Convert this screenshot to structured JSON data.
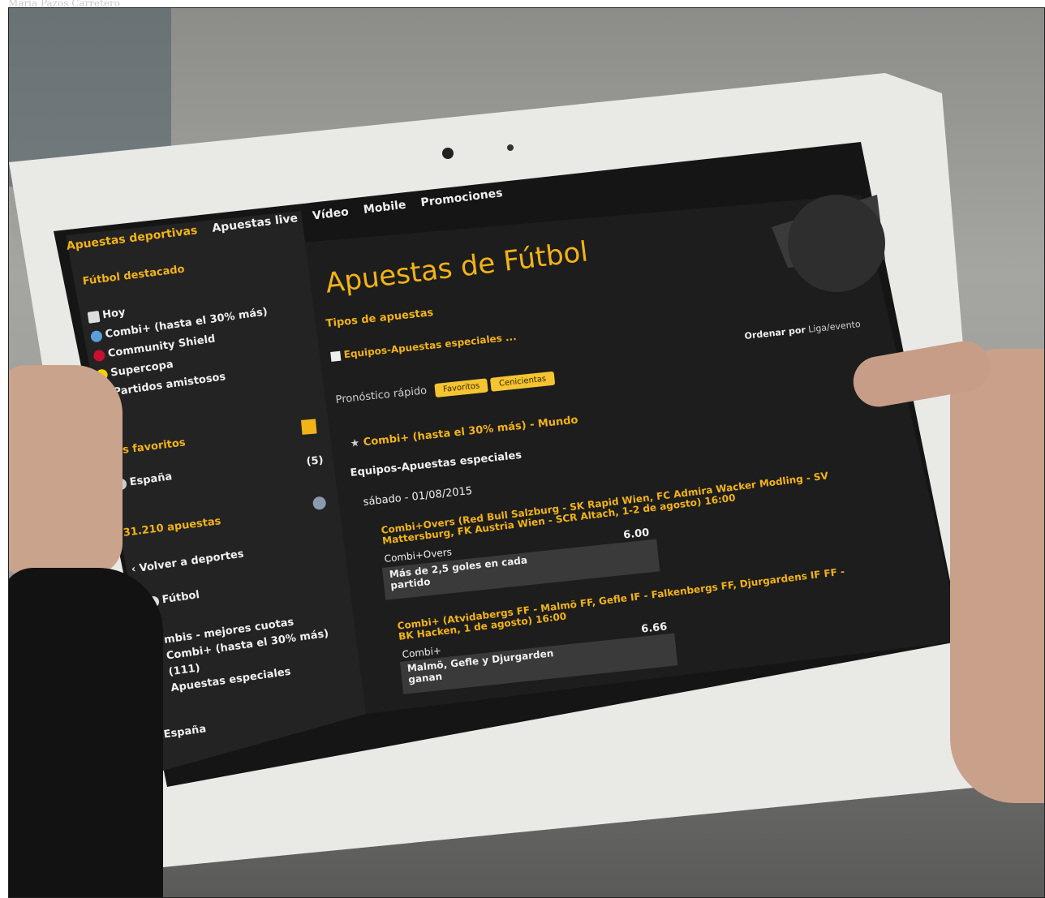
{
  "photo_credit": "María Pazos Carretero",
  "nav": {
    "items": [
      "Apuestas deportivas",
      "Apuestas live",
      "Vídeo",
      "Mobile",
      "Promociones"
    ]
  },
  "sidebar": {
    "featured_title": "Fútbol destacado",
    "featured": [
      "Hoy",
      "Combi+ (hasta el 30% más)",
      "Community Shield",
      "Supercopa",
      "Partidos amistosos"
    ],
    "favorites_title": "Mis favoritos",
    "favorites_item": "España",
    "favorites_count": "(5)",
    "bets_count": "31.210 apuestas",
    "back": "Volver a deportes",
    "sport": "Fútbol",
    "sub_items": [
      "mbis - mejores cuotas",
      "Combi+ (hasta el 30% más)",
      "(111)",
      "Apuestas especiales"
    ],
    "country": "España"
  },
  "main": {
    "title": "Apuestas de Fútbol",
    "bet_types_label": "Tipos de apuestas",
    "checkbox_label": "Equipos-Apuestas especiales ...",
    "order_label": "Ordenar por",
    "order_value": "Liga/evento",
    "quick_label": "Pronóstico rápido",
    "quick_buttons": [
      "Favoritos",
      "Cenicientas"
    ],
    "section_title": "Combi+ (hasta el 30% más) - Mundo",
    "subsection": "Equipos-Apuestas especiales",
    "date": "sábado - 01/08/2015",
    "bets": [
      {
        "title1": "Combi+Overs (Red Bull Salzburg - SK Rapid Wien, FC Admira Wacker Modling - SV",
        "title2": "Mattersburg, FK Austria Wien - SCR Altach, 1-2 de agosto)",
        "time": "16:00",
        "market": "Combi+Overs",
        "selection1": "Más de 2,5 goles en cada",
        "selection2": "partido",
        "odds": "6.00"
      },
      {
        "title1": "Combi+ (Atvidabergs FF - Malmö FF, Gefle IF - Falkenbergs FF, Djurgardens IF FF -",
        "title2": "BK Hacken, 1 de agosto)",
        "time": "16:00",
        "market": "Combi+",
        "selection1": "Malmö, Gefle y Djurgarden",
        "selection2": "ganan",
        "odds": "6.66"
      }
    ]
  },
  "colors": {
    "accent": "#f2b318",
    "screen_bg": "#151515",
    "tablet_frame": "#e9e9e6"
  }
}
